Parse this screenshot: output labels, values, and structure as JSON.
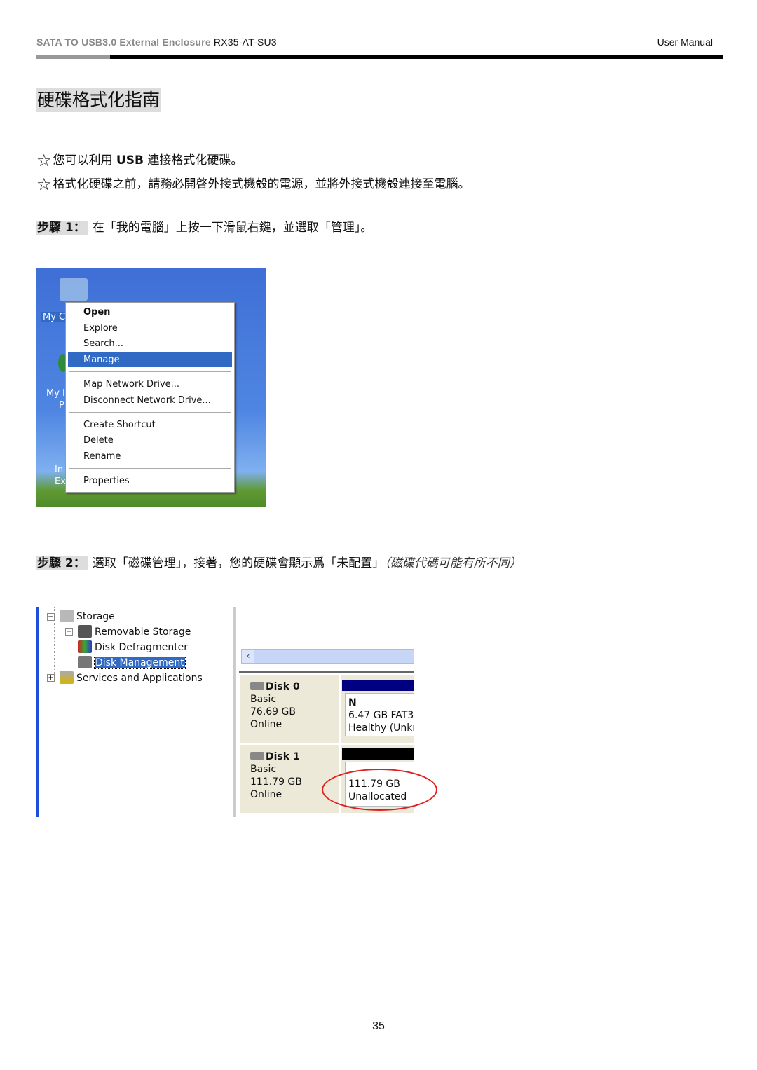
{
  "header": {
    "left_gray": "SATA  TO  USB3.0  External  Enclosure",
    "left_model": "RX35-AT-SU3",
    "right": "User  Manual"
  },
  "title": "硬碟格式化指南",
  "bullets": [
    {
      "icon": "star-outline-icon",
      "pre": "您可以利用 ",
      "bold": "USB",
      "post": " 連接格式化硬碟。"
    },
    {
      "icon": "star-outline-icon",
      "pre": "格式化硬碟之前，請務必開啓外接式機殼的電源，並將外接式機殼連接至電腦。",
      "bold": "",
      "post": ""
    }
  ],
  "step1": {
    "label": "步驟 1：",
    "text": "在「我的電腦」上按一下滑鼠右鍵，並選取「管理」。"
  },
  "step2": {
    "label": "步驟 2：",
    "text": "選取「磁碟管理」，接著，您的硬碟會顯示爲「未配置」",
    "italic": "（磁碟代碼可能有所不同）"
  },
  "desktop": {
    "icon1": "My C",
    "icon2a": "My I",
    "icon2b": "P",
    "icon3a": "In",
    "icon3b": "Ex"
  },
  "context_menu": {
    "items": [
      "Open",
      "Explore",
      "Search...",
      "Manage",
      "Map Network Drive...",
      "Disconnect Network Drive...",
      "Create Shortcut",
      "Delete",
      "Rename",
      "Properties"
    ],
    "selected": "Manage",
    "highlight": "#316ac5"
  },
  "tree": {
    "items": [
      "Storage",
      "Removable Storage",
      "Disk Defragmenter",
      "Disk Management",
      "Services and Applications"
    ],
    "selected": "Disk Management"
  },
  "disks": [
    {
      "name": "Disk 0",
      "type": "Basic",
      "size": "76.69 GB",
      "status": "Online",
      "vol_letter": "N",
      "vol_size": "6.47 GB FAT3:",
      "vol_status": "Healthy (Unkn",
      "bar_color": "#000080"
    },
    {
      "name": "Disk 1",
      "type": "Basic",
      "size": "111.79 GB",
      "status": "Online",
      "vol_size": "111.79 GB",
      "vol_status": "Unallocated",
      "bar_color": "#000000"
    }
  ],
  "annotation_color": "#e02020",
  "page_number": "35"
}
